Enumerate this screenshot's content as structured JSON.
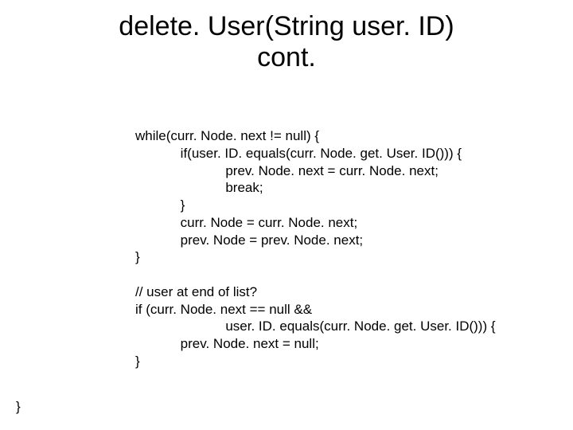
{
  "title_line1": "delete. User(String user. ID)",
  "title_line2": "cont.",
  "code": "while(curr. Node. next != null) {\n            if(user. ID. equals(curr. Node. get. User. ID())) {\n                        prev. Node. next = curr. Node. next;\n                        break;\n            }\n            curr. Node = curr. Node. next;\n            prev. Node = prev. Node. next;\n}\n\n// user at end of list?\nif (curr. Node. next == null &&\n                        user. ID. equals(curr. Node. get. User. ID())) {\n            prev. Node. next = null;\n}",
  "outer_close": "}"
}
